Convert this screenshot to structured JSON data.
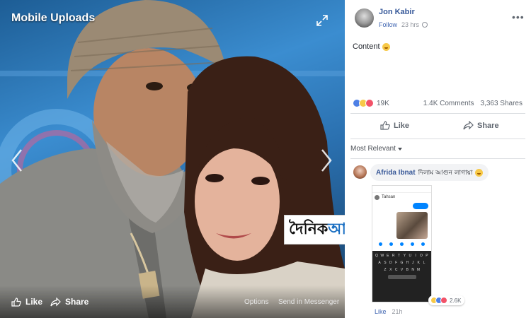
{
  "viewer": {
    "title": "Mobile Uploads",
    "like_label": "Like",
    "share_label": "Share",
    "options_label": "Options",
    "messenger_label": "Send in Messenger"
  },
  "watermark": {
    "part1": "দৈনিক",
    "part2": "আলোকপাত"
  },
  "post": {
    "author": "Jon Kabir",
    "follow_label": "Follow",
    "time": "23 hrs",
    "text": "Content",
    "reaction_count": "19K",
    "comments_count": "1.4K Comments",
    "shares_count": "3,363 Shares",
    "like_label": "Like",
    "share_label": "Share",
    "sort_label": "Most Relevant"
  },
  "comment": {
    "author": "Afrida Ibnat",
    "text": "দিলাম আগুন লাগায়া",
    "reaction_count": "2.6K",
    "like_label": "Like",
    "time": "21h",
    "phone_chat_name": "Tahsan",
    "keyboard_rows": [
      [
        "Q",
        "W",
        "E",
        "R",
        "T",
        "Y",
        "U",
        "I",
        "O",
        "P"
      ],
      [
        "A",
        "S",
        "D",
        "F",
        "G",
        "H",
        "J",
        "K",
        "L"
      ],
      [
        "Z",
        "X",
        "C",
        "V",
        "B",
        "N",
        "M"
      ]
    ]
  },
  "colors": {
    "link": "#365899",
    "accent": "#4267b2",
    "muted": "#90949c"
  },
  "icons": [
    "expand-icon",
    "chevron-left-icon",
    "chevron-right-icon",
    "thumbs-up-icon",
    "share-arrow-icon",
    "globe-icon",
    "more-dots-icon"
  ]
}
